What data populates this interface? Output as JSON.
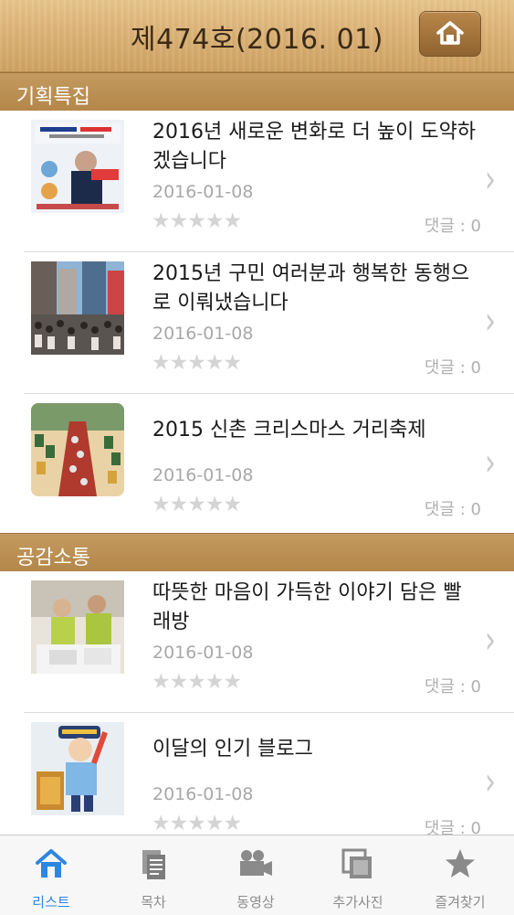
{
  "header": {
    "title": "제474호(2016. 01)"
  },
  "sections": [
    {
      "title": "기획특집",
      "items": [
        {
          "title": "2016년 새로운 변화로 더 높이 도약하겠습니다",
          "date": "2016-01-08",
          "stars": "★★★★★",
          "comment": "댓글 : 0",
          "rating": 0
        },
        {
          "title": "2015년 구민 여러분과 행복한 동행으로 이뤄냈습니다",
          "date": "2016-01-08",
          "stars": "★★★★★",
          "comment": "댓글 : 0",
          "rating": 0
        },
        {
          "title": "2015 신촌 크리스마스 거리축제",
          "date": "2016-01-08",
          "stars": "★★★★★",
          "comment": "댓글 : 0",
          "rating": 0
        }
      ]
    },
    {
      "title": "공감소통",
      "items": [
        {
          "title": "따뜻한 마음이 가득한 이야기 담은 빨래방",
          "date": "2016-01-08",
          "stars": "★★★★★",
          "comment": "댓글 : 0",
          "rating": 0
        },
        {
          "title": "이달의 인기 블로그",
          "date": "2016-01-08",
          "stars": "★★★★★",
          "comment": "댓글 : 0",
          "rating": 0
        }
      ]
    }
  ],
  "tabs": [
    {
      "label": "리스트",
      "icon": "home-icon",
      "active": true
    },
    {
      "label": "목차",
      "icon": "document-icon",
      "active": false
    },
    {
      "label": "동영상",
      "icon": "video-camera-icon",
      "active": false
    },
    {
      "label": "추가사진",
      "icon": "photos-icon",
      "active": false
    },
    {
      "label": "즐겨찾기",
      "icon": "star-icon",
      "active": false
    }
  ],
  "colors": {
    "active_tab": "#2f86e0",
    "section_bar": "#b38649",
    "header_wood": "#dcb378"
  }
}
